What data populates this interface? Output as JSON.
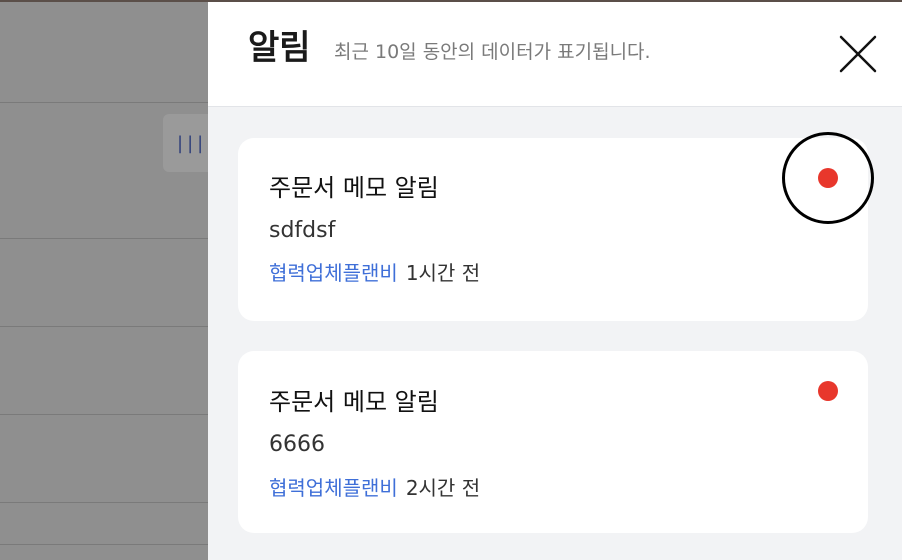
{
  "drawer": {
    "title": "알림",
    "subtitle": "최근 10일 동안의 데이터가 표기됩니다."
  },
  "background": {
    "pill_text": "|||"
  },
  "notifications": [
    {
      "title": "주문서 메모 알림",
      "body": "sdfdsf",
      "company": "협력업체플랜비",
      "time": "1시간 전",
      "unread": true
    },
    {
      "title": "주문서 메모 알림",
      "body": "6666",
      "company": "협력업체플랜비",
      "time": "2시간 전",
      "unread": true
    }
  ],
  "colors": {
    "accent_link": "#3f6fd8",
    "unread_dot": "#e8372c",
    "overlay": "#8f8f8f"
  },
  "icons": {
    "close": "close-icon"
  }
}
